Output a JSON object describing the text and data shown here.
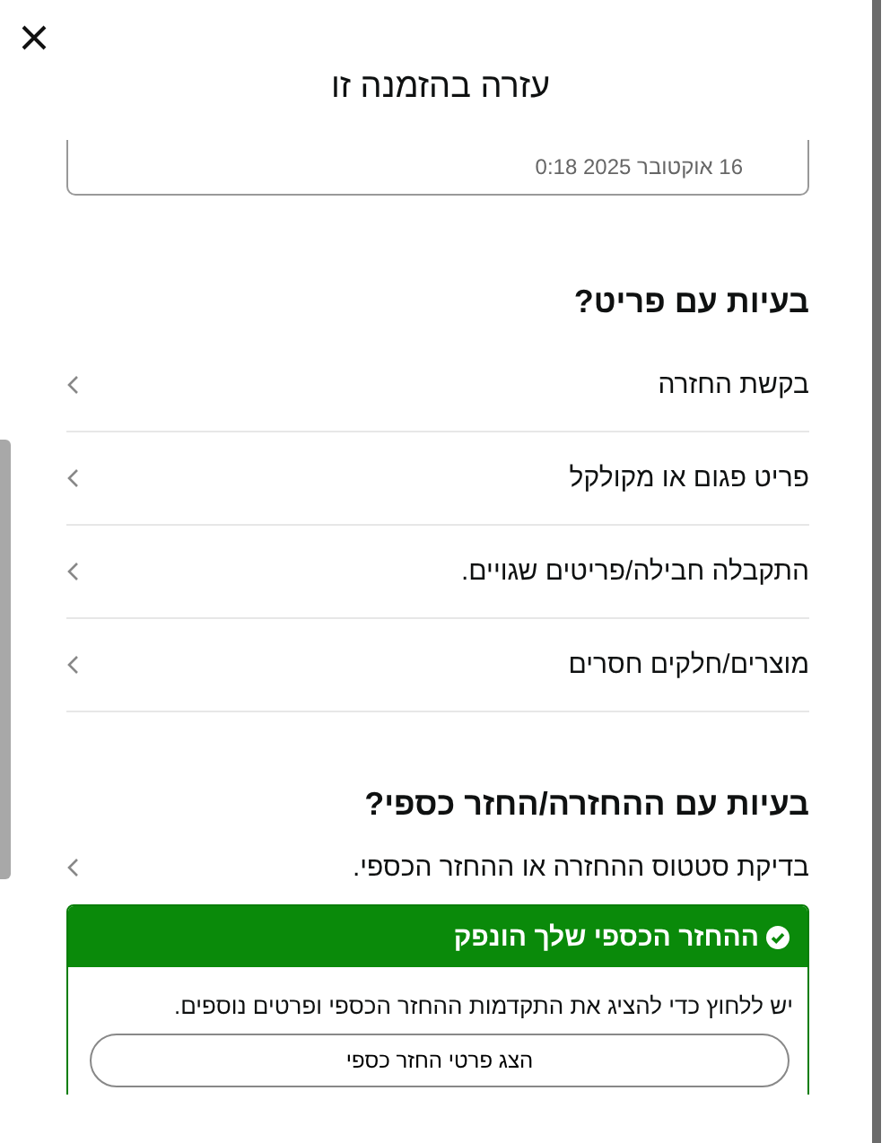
{
  "dialog": {
    "title": "עזרה בהזמנה זו"
  },
  "order_card": {
    "date": "16 אוקטובר 2025 0:18"
  },
  "sections": [
    {
      "heading": "בעיות עם פריט?",
      "items": [
        {
          "label": "בקשת החזרה"
        },
        {
          "label": "פריט פגום או מקולקל"
        },
        {
          "label": "התקבלה חבילה/פריטים שגויים."
        },
        {
          "label": "מוצרים/חלקים חסרים"
        }
      ]
    },
    {
      "heading": "בעיות עם ההחזרה/החזר כספי?",
      "items": [
        {
          "label": "בדיקת סטטוס ההחזרה או ההחזר הכספי."
        }
      ]
    }
  ],
  "refund_notice": {
    "title": "ההחזר הכספי שלך הונפק",
    "message": "יש ללחוץ כדי להציג את התקדמות ההחזר הכספי ופרטים נוספים.",
    "button": "הצג פרטי החזר כספי"
  }
}
